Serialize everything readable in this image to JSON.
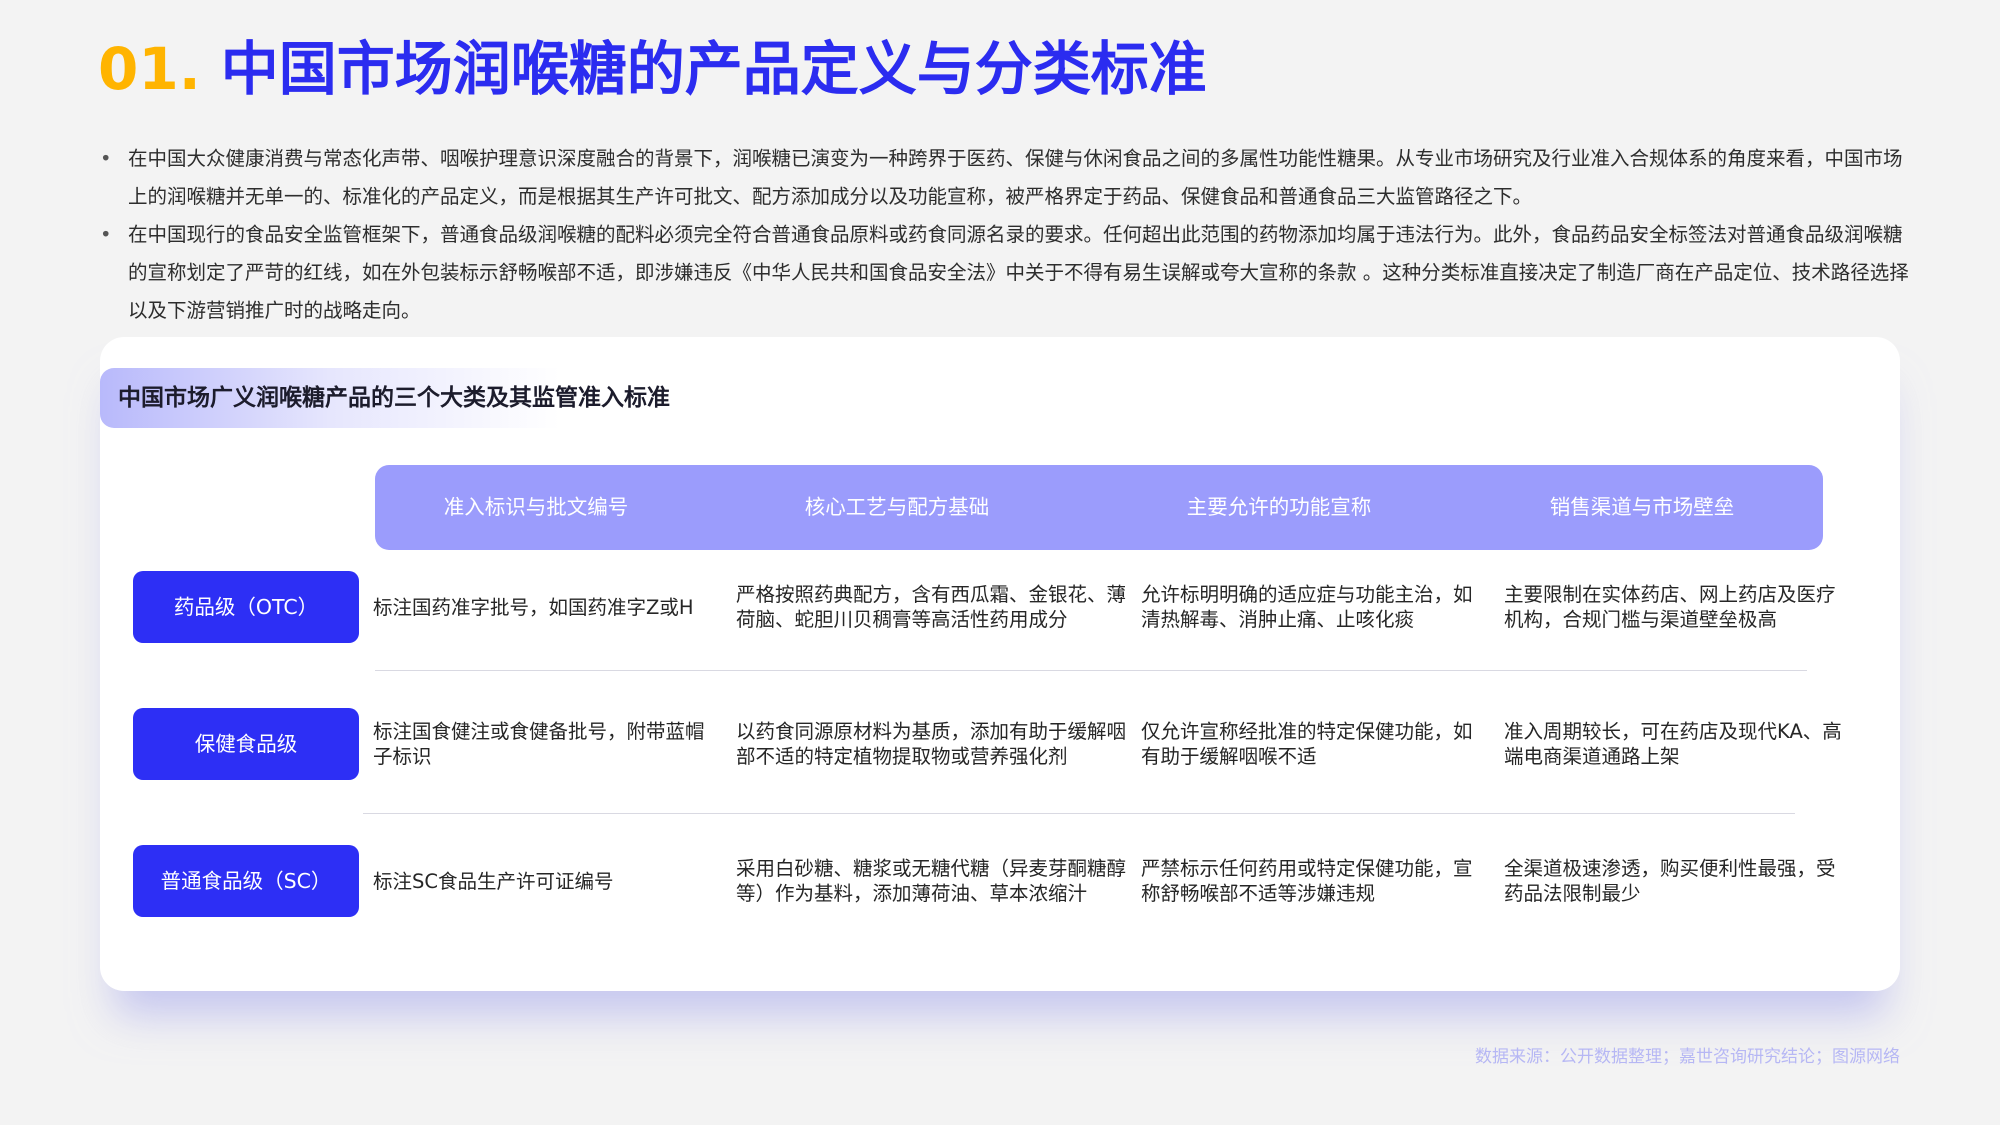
{
  "title": {
    "number": "01.",
    "text": "中国市场润喉糖的产品定义与分类标准"
  },
  "bullets": [
    "在中国大众健康消费与常态化声带、咽喉护理意识深度融合的背景下，润喉糖已演变为一种跨界于医药、保健与休闲食品之间的多属性功能性糖果。从专业市场研究及行业准入合规体系的角度来看，中国市场上的润喉糖并无单一的、标准化的产品定义，而是根据其生产许可批文、配方添加成分以及功能宣称，被严格界定于药品、保健食品和普通食品三大监管路径之下。",
    "在中国现行的食品安全监管框架下，普通食品级润喉糖的配料必须完全符合普通食品原料或药食同源名录的要求。任何超出此范围的药物添加均属于违法行为。此外，食品药品安全标签法对普通食品级润喉糖的宣称划定了严苛的红线，如在外包装标示舒畅喉部不适，即涉嫌违反《中华人民共和国食品安全法》中关于不得有易生误解或夸大宣称的条款 。这种分类标准直接决定了制造厂商在产品定位、技术路径选择以及下游营销推广时的战略走向。"
  ],
  "table": {
    "title": "中国市场广义润喉糖产品的三个大类及其监管准入标准",
    "headers": [
      "准入标识与批文编号",
      "核心工艺与配方基础",
      "主要允许的功能宣称",
      "销售渠道与市场壁垒"
    ],
    "rows": [
      {
        "label": "药品级（OTC）",
        "cells": [
          "标注国药准字批号，如国药准字Z或H",
          "严格按照药典配方，含有西瓜霜、金银花、薄荷脑、蛇胆川贝稠膏等高活性药用成分",
          "允许标明明确的适应症与功能主治，如清热解毒、消肿止痛、止咳化痰",
          "主要限制在实体药店、网上药店及医疗机构，合规门槛与渠道壁垒极高"
        ]
      },
      {
        "label": "保健食品级",
        "cells": [
          "标注国食健注或食健备批号，附带蓝帽子标识",
          "以药食同源原材料为基质，添加有助于缓解咽部不适的特定植物提取物或营养强化剂",
          "仅允许宣称经批准的特定保健功能，如有助于缓解咽喉不适",
          "准入周期较长，可在药店及现代KA、高端电商渠道通路上架"
        ]
      },
      {
        "label": "普通食品级（SC）",
        "cells": [
          "标注SC食品生产许可证编号",
          "采用白砂糖、糖浆或无糖代糖（异麦芽酮糖醇等）作为基料，添加薄荷油、草本浓缩汁",
          "严禁标示任何药用或特定保健功能，宣称舒畅喉部不适等涉嫌违规",
          "全渠道极速渗透，购买便利性最强，受药品法限制最少"
        ]
      }
    ]
  },
  "source": "数据来源：公开数据整理；嘉世咨询研究结论；图源网络",
  "colors": {
    "title_number": "#ffb400",
    "title_text": "#2b2cf0",
    "header_bg": "#9b9cfc",
    "row_label_bg": "#2d2ff5",
    "source_text": "#b6b7f4"
  }
}
